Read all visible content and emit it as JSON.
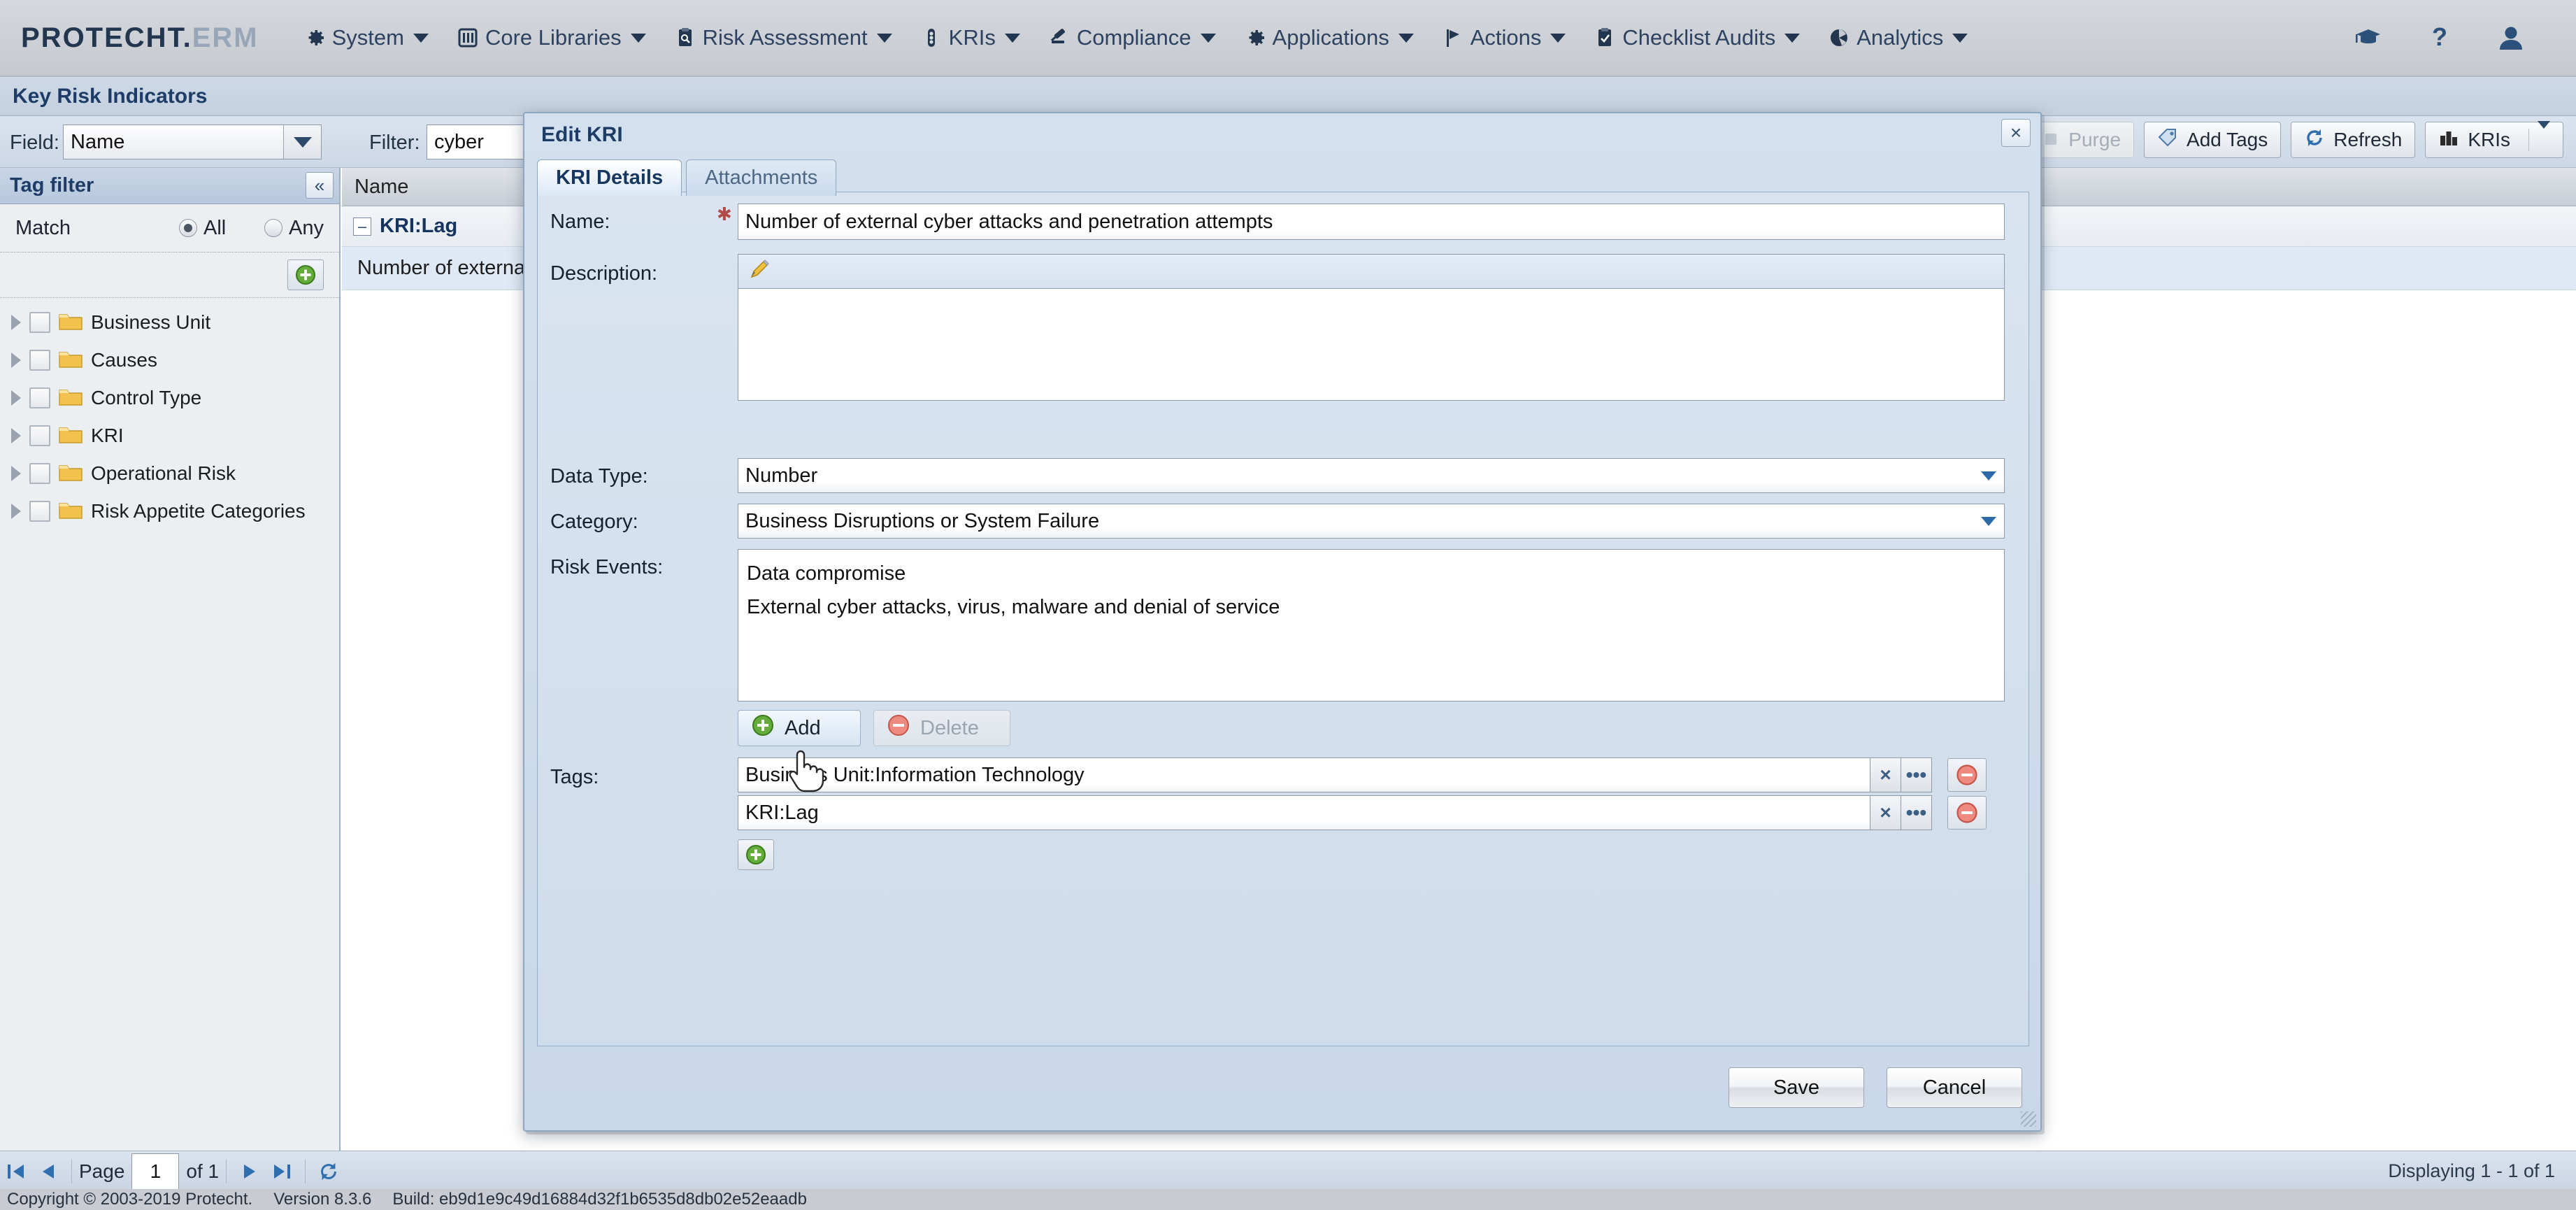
{
  "app": {
    "brand_main": "PROTECHT.",
    "brand_suffix": "ERM"
  },
  "topnav": {
    "items": [
      {
        "label": "System",
        "icon": "gear-icon"
      },
      {
        "label": "Core Libraries",
        "icon": "library-icon"
      },
      {
        "label": "Risk Assessment",
        "icon": "clipboard-search-icon"
      },
      {
        "label": "KRIs",
        "icon": "traffic-light-icon"
      },
      {
        "label": "Compliance",
        "icon": "gavel-icon"
      },
      {
        "label": "Applications",
        "icon": "gear-icon"
      },
      {
        "label": "Actions",
        "icon": "flag-icon"
      },
      {
        "label": "Checklist Audits",
        "icon": "clipboard-check-icon"
      },
      {
        "label": "Analytics",
        "icon": "pie-chart-icon"
      }
    ],
    "right_icons": [
      {
        "name": "graduation-cap-icon"
      },
      {
        "name": "help-question-icon"
      },
      {
        "name": "user-avatar-icon"
      }
    ]
  },
  "page": {
    "title": "Key Risk Indicators"
  },
  "filter_bar": {
    "field_label": "Field:",
    "field_value": "Name",
    "filter_label": "Filter:",
    "filter_value": "cyber",
    "filter_placeholder": ""
  },
  "tag_filter": {
    "title": "Tag filter",
    "collapse_icon": "«",
    "match_label": "Match",
    "match_all_label": "All",
    "match_any_label": "Any",
    "match_selected": "All",
    "add_button_icon": "green-plus-icon",
    "tree": [
      {
        "label": "Business Unit"
      },
      {
        "label": "Causes"
      },
      {
        "label": "Control Type"
      },
      {
        "label": "KRI"
      },
      {
        "label": "Operational Risk"
      },
      {
        "label": "Risk Appetite Categories"
      }
    ]
  },
  "grid": {
    "column_header": "Name",
    "group_row": "KRI:Lag",
    "rows": [
      {
        "name": "Number of external cyber attacks and penetration attempts"
      }
    ],
    "toolbar": [
      {
        "label": "Purge",
        "icon": "purge-icon",
        "disabled": true
      },
      {
        "label": "Add Tags",
        "icon": "tag-icon",
        "disabled": false
      },
      {
        "label": "Refresh",
        "icon": "refresh-icon",
        "disabled": false
      },
      {
        "label": "KRIs",
        "icon": "kri-icon",
        "disabled": false,
        "split": true
      }
    ]
  },
  "modal": {
    "title": "Edit KRI",
    "close_label": "×",
    "tabs": [
      {
        "label": "KRI Details",
        "active": true
      },
      {
        "label": "Attachments",
        "active": false
      }
    ],
    "fields": {
      "name_label": "Name:",
      "name_value": "Number of external cyber attacks and penetration attempts",
      "name_required": true,
      "description_label": "Description:",
      "description_value": "",
      "description_toolbar_icon": "pencil-edit-icon",
      "data_type_label": "Data Type:",
      "data_type_value": "Number",
      "category_label": "Category:",
      "category_value": "Business Disruptions or System Failure",
      "risk_events_label": "Risk Events:",
      "risk_events": [
        "Data compromise",
        "External cyber attacks, virus, malware and denial of service"
      ],
      "tags_label": "Tags:",
      "tags": [
        "Business Unit:Information Technology",
        "KRI:Lag"
      ]
    },
    "buttons": {
      "add_label": "Add",
      "add_icon": "green-plus-icon",
      "delete_label": "Delete",
      "delete_icon": "red-minus-icon",
      "delete_disabled": true,
      "add_tag_icon": "green-plus-icon",
      "tag_clear_icon": "×",
      "tag_browse_icon": "•••",
      "tag_remove_icon": "red-minus-icon",
      "save_label": "Save",
      "cancel_label": "Cancel"
    }
  },
  "pager": {
    "first_icon": "first-page-icon",
    "prev_icon": "prev-page-icon",
    "page_label": "Page",
    "page_value": "1",
    "of_label": "of 1",
    "next_icon": "next-page-icon",
    "last_icon": "last-page-icon",
    "refresh_icon": "refresh-icon",
    "displaying": "Displaying 1 - 1 of 1"
  },
  "footer": {
    "copyright": "Copyright © 2003-2019 Protecht.",
    "version": "Version 8.3.6",
    "build": "Build: eb9d1e9c49d16884d32f1b6535d8db02e52eaadb"
  },
  "colors": {
    "brand_navy": "#22364f",
    "accent_blue": "#1d3d66",
    "required_red": "#b34a4a",
    "green": "#4f9f27",
    "red": "#e06a60"
  }
}
